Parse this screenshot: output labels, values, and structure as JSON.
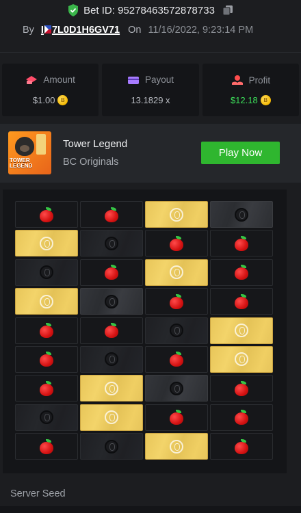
{
  "header": {
    "bet_id_label": "Bet ID: 95278463572878733",
    "by_label": "By",
    "username_prefix": "I",
    "username_suffix": "7L0D1H6GV71",
    "on_label": "On",
    "datetime": "11/16/2022, 9:23:14 PM"
  },
  "stats": [
    {
      "label": "Amount",
      "value": "$1.00",
      "has_coin": true,
      "color": "#b8bbc1"
    },
    {
      "label": "Payout",
      "value": "13.1829 x",
      "has_coin": false,
      "color": "#b8bbc1"
    },
    {
      "label": "Profit",
      "value": "$12.18",
      "has_coin": true,
      "color": "#3ce05a"
    }
  ],
  "game": {
    "name": "Tower Legend",
    "provider": "BC Originals",
    "thumb_text": "TOWER LEGEND",
    "play_label": "Play Now"
  },
  "board": {
    "rows": [
      [
        "apple",
        "apple",
        "gold",
        "dark"
      ],
      [
        "gold",
        "dim",
        "apple",
        "apple"
      ],
      [
        "dim",
        "apple",
        "gold",
        "apple"
      ],
      [
        "gold",
        "dark",
        "apple",
        "apple"
      ],
      [
        "apple",
        "apple",
        "dim",
        "gold"
      ],
      [
        "apple",
        "dim",
        "apple",
        "gold"
      ],
      [
        "apple",
        "gold",
        "dark",
        "apple"
      ],
      [
        "dim",
        "gold",
        "apple",
        "apple"
      ],
      [
        "apple",
        "dim",
        "gold",
        "apple"
      ]
    ]
  },
  "server_seed_label": "Server Seed",
  "colors": {
    "accent_green": "#2fb62f",
    "profit_green": "#3ce05a",
    "gold_tile": "#f0cf63"
  }
}
